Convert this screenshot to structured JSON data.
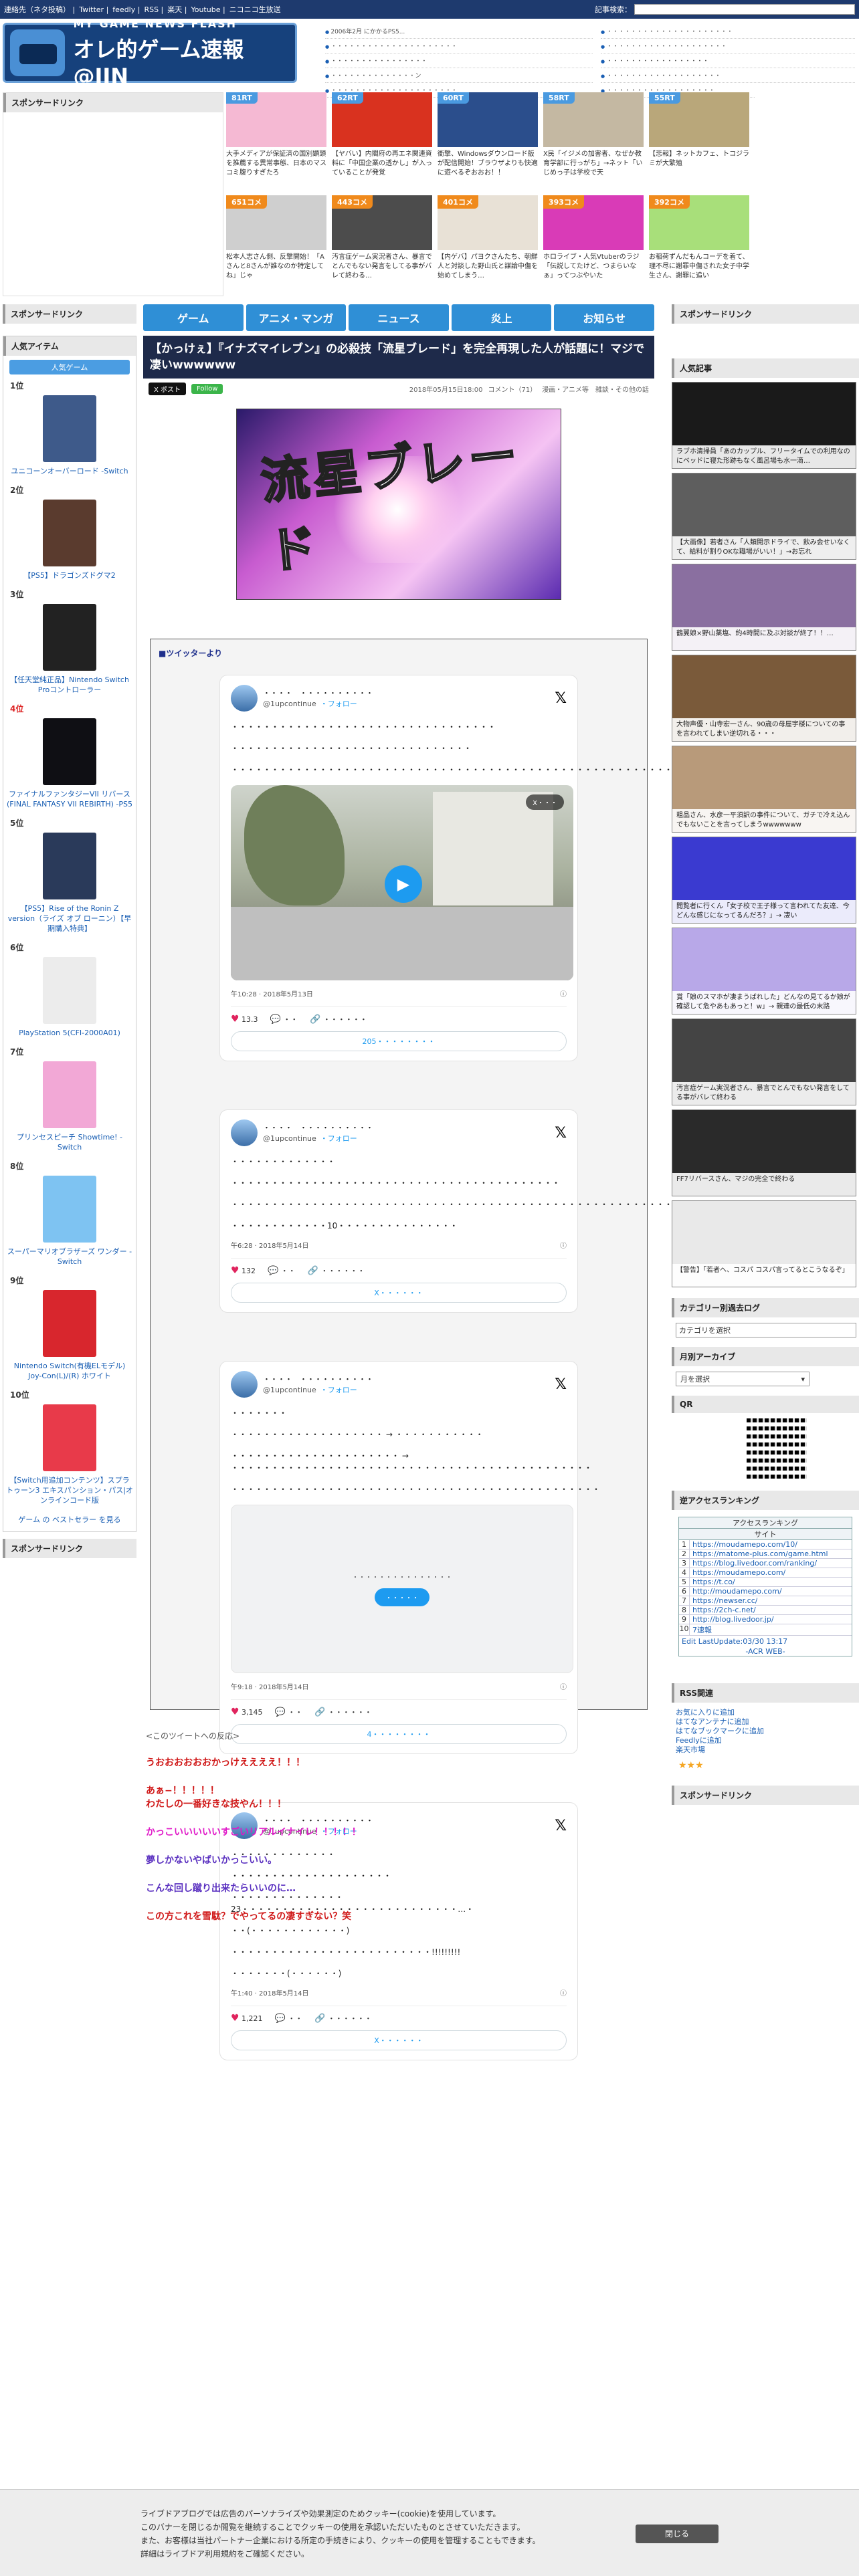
{
  "topbar": {
    "links": [
      "連絡先（ネタ投稿）",
      "Twitter",
      "feedly",
      "RSS",
      "楽天",
      "Youtube",
      "ニコニコ生放送"
    ],
    "search_label": "記事検索：",
    "search_placeholder": ""
  },
  "header": {
    "logo_small": "MY GAME NEWS FLASH",
    "logo_big": "オレ的ゲーム速報@JIN",
    "news_col1": [
      "2006年2月 にかかるPS5...",
      "・・・・・・・・・・・・・・・・・・・・・",
      "・・・・・・・・・・・・・・・・",
      "・・・・・・・・・・・・・・ン",
      "・・・・・・・・・・・・・・・・・・・・・"
    ],
    "news_col2": [
      "・・・・・・・・・・・・・・・・・・・・・",
      "・・・・・・・・・・・・・・・・・・・・",
      "・・・・・・・・・・・・・・・・・",
      "・・・・・・・・・・・・・・・・・・・",
      "・・・・・・・・・・・・・・・・・・"
    ]
  },
  "sponsor_top": {
    "title": "スポンサードリンク"
  },
  "tiles": [
    {
      "badge": "81RT",
      "badge_color": "#4a9ae0",
      "thumb": "#f5b9d3",
      "caption": "大手メディアが保証済の国別顕頭を推薦する異常事態、日本のマスコミ腹りすぎたろ"
    },
    {
      "badge": "62RT",
      "badge_color": "#4a9ae0",
      "thumb": "#d9321f",
      "caption": "【ヤバい】内閣府の再エネ関連資料に「中国企業の透かし」が入っていることが発覚"
    },
    {
      "badge": "60RT",
      "badge_color": "#4a9ae0",
      "thumb": "#2b4e8c",
      "caption": "衝撃、Windowsダウンロード版が配信開始！ブラウザよりも快適に遊べるぞおおお！！"
    },
    {
      "badge": "58RT",
      "badge_color": "#4a9ae0",
      "thumb": "#c4b8a2",
      "caption": "X民「イジメの加害者、なぜか教育学部に行っがち」→ネット「いじめっ子は学校で天"
    },
    {
      "badge": "55RT",
      "badge_color": "#4a9ae0",
      "thumb": "#b9a77a",
      "caption": "【悲報】ネットカフェ、トコジラミが大繁殖"
    },
    {
      "badge": "",
      "badge_color": "#4a9ae0",
      "thumb": "#ffffff",
      "caption": ""
    },
    {
      "badge": "651コメ",
      "badge_color": "#f08a1c",
      "thumb": "#cfcfcf",
      "caption": "松本人志さん側、反撃開始！「Aさんと8さんが誰なのか特定してね」じゃ"
    },
    {
      "badge": "443コメ",
      "badge_color": "#f08a1c",
      "thumb": "#4c4c4c",
      "caption": "汚言症ゲーム実況者さん、暴言でとんでもない発言をしてる事がバレて終わる…"
    },
    {
      "badge": "401コメ",
      "badge_color": "#f08a1c",
      "thumb": "#e8e1d6",
      "caption": "【内ゲバ】パヨクさんたち、朝鮮人と対談した野山氏と謀論中傷を始めてしまう…"
    },
    {
      "badge": "393コメ",
      "badge_color": "#f08a1c",
      "thumb": "#d93bb7",
      "caption": "ホロライブ・人気Vtuberのラジ「伝説してたけど、つまらいなぁ」ってつぶやいた"
    },
    {
      "badge": "392コメ",
      "badge_color": "#f08a1c",
      "thumb": "#a8df7a",
      "caption": "お稲荷ずんだもんコーデを着て、理不尽に謝罪中傷された女子中学生さん、謝罪に追い"
    },
    {
      "badge": "",
      "badge_color": "#f08a1c",
      "thumb": "#ffffff",
      "caption": ""
    }
  ],
  "nav": [
    "ゲーム",
    "アニメ・マンガ",
    "ニュース",
    "炎上",
    "お知らせ"
  ],
  "left": {
    "sponsor_title": "スポンサードリンク",
    "popular_title": "人気アイテム",
    "tab": "人気ゲーム",
    "items": [
      {
        "rank": "1位",
        "rank_red": false,
        "img": "#3e5a8a",
        "title": "ユニコーンオーバーロード -Switch"
      },
      {
        "rank": "2位",
        "rank_red": false,
        "img": "#5a3b2e",
        "title": "【PS5】ドラゴンズドグマ2"
      },
      {
        "rank": "3位",
        "rank_red": false,
        "img": "#222222",
        "title": "【任天堂純正品】Nintendo Switch Proコントローラー"
      },
      {
        "rank": "4位",
        "rank_red": true,
        "img": "#0f0f14",
        "title": "ファイナルファンタジーVII リバース(FINAL FANTASY VII REBIRTH) -PS5"
      },
      {
        "rank": "5位",
        "rank_red": false,
        "img": "#2a3a5a",
        "title": "【PS5】Rise of the Ronin Z version（ライズ オブ ローニン）【早期購入特典】"
      },
      {
        "rank": "6位",
        "rank_red": false,
        "img": "#ececec",
        "title": "PlayStation 5(CFI-2000A01)"
      },
      {
        "rank": "7位",
        "rank_red": false,
        "img": "#f2a8d6",
        "title": "プリンセスピーチ Showtime! -Switch"
      },
      {
        "rank": "8位",
        "rank_red": false,
        "img": "#7ec3f2",
        "title": "スーパーマリオブラザーズ ワンダー -Switch"
      },
      {
        "rank": "9位",
        "rank_red": false,
        "img": "#d8262d",
        "title": "Nintendo Switch(有機ELモデル) Joy-Con(L)/(R) ホワイト"
      },
      {
        "rank": "10位",
        "rank_red": false,
        "img": "#e83a4a",
        "title": "【Switch用追加コンテンツ】スプラトゥーン3 エキスパンション・パス|オンラインコード版"
      }
    ],
    "bestseller": "ゲーム の ベストセラー を見る",
    "sponsor_bottom": "スポンサードリンク"
  },
  "article": {
    "title": "【かっけぇ】『イナズマイレブン』の必殺技「流星ブレード」を完全再現した人が話題に！マジで凄いwwwwww",
    "x_button": "X ポスト",
    "follow_button": "Follow",
    "date": "2018年05月15日18:00",
    "comments": "コメント（71）",
    "categories": "漫画・アニメ等　雑談・その他の話",
    "hero_text": "流星ブレード",
    "quote_head": "■ツイッターより"
  },
  "tweets": [
    {
      "name": "・・・・　・・・・・・・・・・",
      "handle": "@1upcontinue",
      "follow": "・フォロー",
      "lines": [
        "・・・・・・・・・・・・・・・・・・・・・・・・・・・・・・・・・",
        "・・・・・・・・・・・・・・・・・・・・・・・・・・・・・・",
        "・・・・・・・・・・・・・・・・・・・・・・・・・・・・・・・・・・・・・・・・・・・・・・・・・・・・・・・・・"
      ],
      "media": "video",
      "video_label": "X・・・",
      "time": "午10:28 · 2018年5月13日",
      "likes": "13.3",
      "reply": "・・",
      "copy": "・・・・・・",
      "more": "205・・・・・・・・"
    },
    {
      "name": "・・・・　・・・・・・・・・・",
      "handle": "@1upcontinue",
      "follow": "・フォロー",
      "lines": [
        "・・・・・・・・・・・・・",
        "・・・・・・・・・・・・・・・・・・・・・・・・・・・・・・・・・・・・・・・・・",
        "・・・・・・・・・・・・・・・・・・・・・・・・・・・・・・・・・・・・・・・・・・・・・・・・・・・・・・・・・・・・・・・",
        "・・・・・・・・・・・・10・・・・・・・・・・・・・・・"
      ],
      "media": "none",
      "time": "午6:28 · 2018年5月14日",
      "likes": "132",
      "reply": "・・",
      "copy": "・・・・・・",
      "more": "X・・・・・・"
    },
    {
      "name": "・・・・　・・・・・・・・・・",
      "handle": "@1upcontinue",
      "follow": "・フォロー",
      "lines": [
        "・・・・・・・",
        "・・・・・・・・・・・・・・・・・・・ → ・・・・・・・・・・・",
        "・・・・・・・・・・・・・・・・・・・・・ → ・・・・・・・・・・・・・・・・・・・・・・・・・・・・・・・・・・・・・・・・・・・・・",
        "・・・・・・・・・・・・・・・・・・・・・・・・・・・・・・・・・・・・・・・・・・・・・・"
      ],
      "media": "placeholder",
      "placeholder_msg": "・・・・・・・・・・・・・・・",
      "placeholder_btn": "・・・・・",
      "time": "午9:18 · 2018年5月14日",
      "likes": "3,145",
      "reply": "・・",
      "copy": "・・・・・・",
      "more": "4・・・・・・・・"
    },
    {
      "name": "・・・・　・・・・・・・・・・",
      "handle": "@1upcontinue",
      "follow": "・フォロー",
      "lines": [
        "・・・・・・・・・・・・・",
        "・・・・・・・・・・・・・・・・・・・・",
        "・・・・・・・・・・・・・・23・・・・・・・・・・・・・・・・・・・・・・・・・・・…・",
        "・・(・・・・・・・・・・・・)",
        "・・・・・・・・・・・・・・・・・・・・・・・・・!!!!!!!!!",
        "・・・・・・・(・・・・・・)"
      ],
      "media": "none",
      "time": "午1:40 · 2018年5月14日",
      "likes": "1,221",
      "reply": "・・",
      "copy": "・・・・・・",
      "more": "X・・・・・・"
    }
  ],
  "reactions": {
    "lead": "<このツイートへの反応>",
    "lines": [
      {
        "text": "うおおおおおおかっけええええ！！！",
        "color": "#d01818"
      },
      {
        "text": "あぁ−！！！！！\nわたしの一番好きな技やん！！！",
        "color": "#d01818"
      },
      {
        "text": "かっこいいいいいすごいリアルイナイレ！！！！！",
        "color": "#e018c8"
      },
      {
        "text": "夢しかないやばいかっこいい。",
        "color": "#5a30c0"
      },
      {
        "text": "こんな回し蹴り出来たらいいのに…",
        "color": "#5a30c0"
      },
      {
        "text": "この方これを雪駄？でやってるの凄すぎない？笑",
        "color": "#d01818"
      }
    ]
  },
  "right": {
    "sponsor_title": "スポンサードリンク",
    "popular_title": "人気記事",
    "popular": [
      {
        "img": "#1a1a1a",
        "text": "ラブホ清掃員「あのカップル、フリータイムでの利用なのにベッドに寝た形跡もなく風呂場も水一滴…"
      },
      {
        "img": "#5e5e5e",
        "text": "【大画像】若者さん「人類開示ドライで、飲み会せいなくて、給料が割りOKな職場がいい！」→お忘れ"
      },
      {
        "img": "#8a6fa0",
        "text": "鶴翼娘×野山薬塩、約4時間に及ぶ対談が終了！！…"
      },
      {
        "img": "#7a5a3a",
        "text": "大物声優・山寺宏一さん、90歳の母屋宇楼についての事を言われてしまい逆切れる・・・"
      },
      {
        "img": "#b89a7a",
        "text": "粗品さん、水彦一平須訳の事件について、ガチで冷え込んでもないことを言ってしまうwwwwwww"
      },
      {
        "img": "#3a3ad0",
        "text": "閲覧者に行くん「女子校で王子様って言われてた友達、今どんな感じになってるんだろ？」→ 凄い"
      },
      {
        "img": "#b8a8e8",
        "text": "賞「娘のスマホが凄まうばれした」どんなの見てるか娘が確認して危やあもあっと！w」→ 親達の最低の末路"
      },
      {
        "img": "#444444",
        "text": "汚言症ゲーム実況者さん、暴言でとんでもない発言をしてる事がバレて終わる"
      },
      {
        "img": "#2a2a2a",
        "text": "FF7リバースさん、マジの完全で終わる"
      },
      {
        "img": "#e9e9e9",
        "text": "【警告】「若者へ、コスパ コスパ言ってるとこうなるぞ」"
      }
    ],
    "category_title": "カテゴリー別過去ログ",
    "category_select": "カテゴリを選択",
    "month_title": "月別アーカイブ",
    "month_select": "月を選択",
    "qr_title": "QR",
    "acr_title": "逆アクセスランキング",
    "acr_head": "アクセスランキング",
    "acr_sub": "サイト",
    "acr_rows": [
      {
        "n": "1",
        "u": "https://moudamepo.com/10/"
      },
      {
        "n": "2",
        "u": "https://matome-plus.com/game.html"
      },
      {
        "n": "3",
        "u": "https://blog.livedoor.com/ranking/"
      },
      {
        "n": "4",
        "u": "https://moudamepo.com/"
      },
      {
        "n": "5",
        "u": "https://t.co/"
      },
      {
        "n": "6",
        "u": "http://moudamepo.com/"
      },
      {
        "n": "7",
        "u": "https://newser.cc/"
      },
      {
        "n": "8",
        "u": "https://2ch-c.net/"
      },
      {
        "n": "9",
        "u": "http://blog.livedoor.jp/"
      },
      {
        "n": "10",
        "u": "7速報"
      }
    ],
    "acr_footer": "Edit LastUpdate:03/30 13:17",
    "acr_web": "-ACR WEB-",
    "rss_title": "RSS関連",
    "rss_links": [
      "お気に入りに追加",
      "はてなアンテナに追加",
      "はてなブックマークに追加",
      "Feedlyに追加",
      "楽天市場"
    ],
    "sponsor_bottom": "スポンサードリンク"
  },
  "cookie": {
    "lines": [
      "ライブドアブログでは広告のパーソナライズや効果測定のためクッキー(cookie)を使用しています。",
      "このバナーを閉じるか閲覧を継続することでクッキーの使用を承認いただいたものとさせていただきます。",
      "また、お客様は当社パートナー企業における所定の手続きにより、クッキーの使用を管理することもできます。",
      "詳細はライブドア利用規約をご確認ください。"
    ],
    "close": "閉じる"
  }
}
